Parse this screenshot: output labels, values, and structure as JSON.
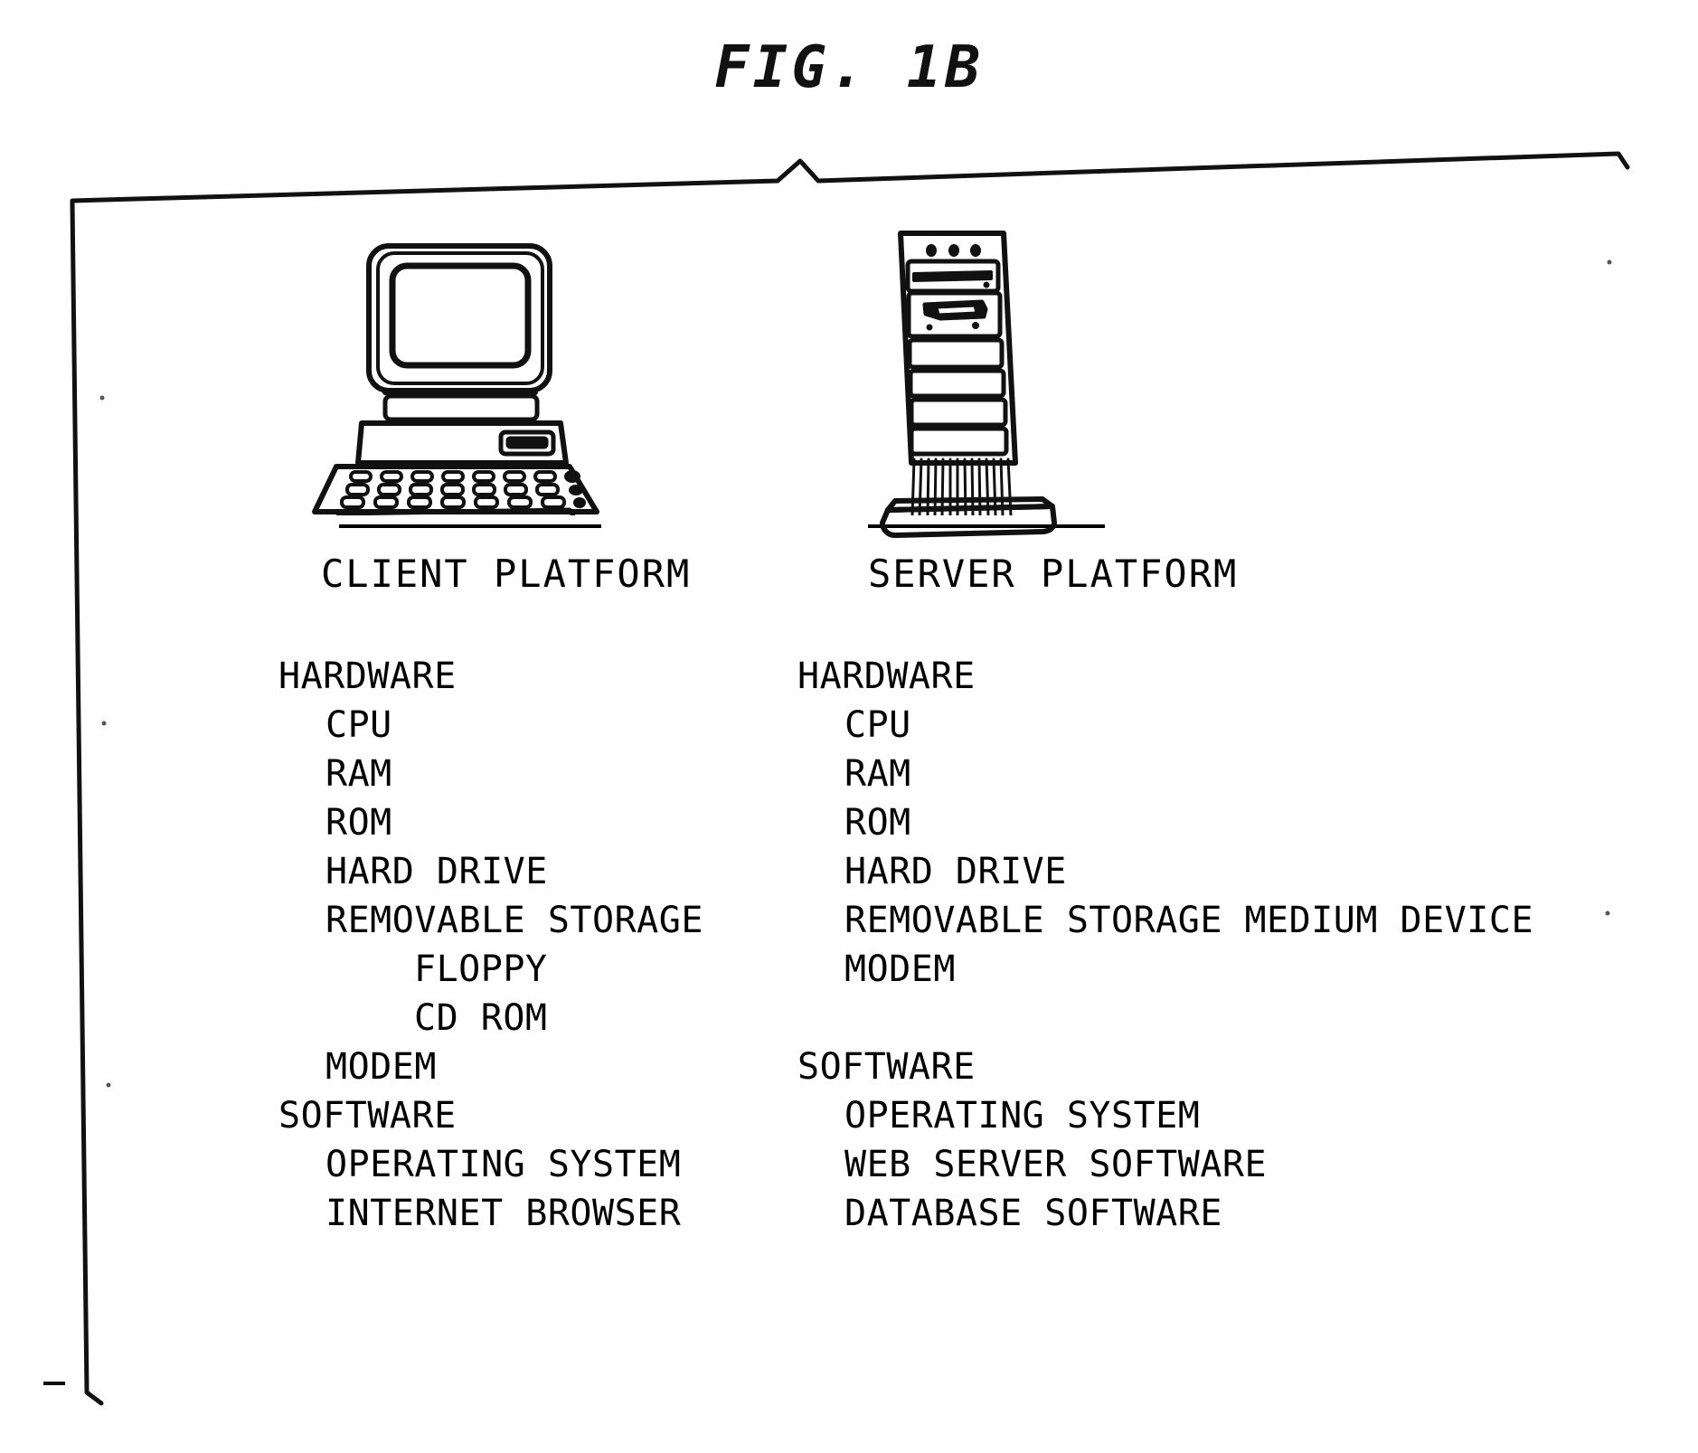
{
  "figure": {
    "title": "FIG. 1B"
  },
  "columns": [
    {
      "id": "client",
      "artwork": "desktop-computer-icon",
      "label": "CLIENT PLATFORM",
      "items": [
        {
          "text": "HARDWARE",
          "level": 0
        },
        {
          "text": "CPU",
          "level": 1
        },
        {
          "text": "RAM",
          "level": 1
        },
        {
          "text": "ROM",
          "level": 1
        },
        {
          "text": "HARD DRIVE",
          "level": 1
        },
        {
          "text": "REMOVABLE STORAGE",
          "level": 1
        },
        {
          "text": "FLOPPY",
          "level": 2
        },
        {
          "text": "CD ROM",
          "level": 2
        },
        {
          "text": "MODEM",
          "level": 1
        },
        {
          "text": "SOFTWARE",
          "level": 0
        },
        {
          "text": "OPERATING SYSTEM",
          "level": 1
        },
        {
          "text": "INTERNET BROWSER",
          "level": 1
        }
      ]
    },
    {
      "id": "server",
      "artwork": "server-tower-icon",
      "label": "SERVER PLATFORM",
      "items": [
        {
          "text": "HARDWARE",
          "level": 0
        },
        {
          "text": "CPU",
          "level": 1
        },
        {
          "text": "RAM",
          "level": 1
        },
        {
          "text": "ROM",
          "level": 1
        },
        {
          "text": "HARD DRIVE",
          "level": 1
        },
        {
          "text": "REMOVABLE STORAGE MEDIUM DEVICE",
          "level": 1
        },
        {
          "text": "MODEM",
          "level": 1
        },
        {
          "text": "",
          "level": 0
        },
        {
          "text": "SOFTWARE",
          "level": 0
        },
        {
          "text": "OPERATING SYSTEM",
          "level": 1
        },
        {
          "text": "WEB SERVER SOFTWARE",
          "level": 1
        },
        {
          "text": "DATABASE SOFTWARE",
          "level": 1
        }
      ]
    }
  ],
  "colors": {
    "ink": "#000000",
    "paper": "#ffffff"
  }
}
